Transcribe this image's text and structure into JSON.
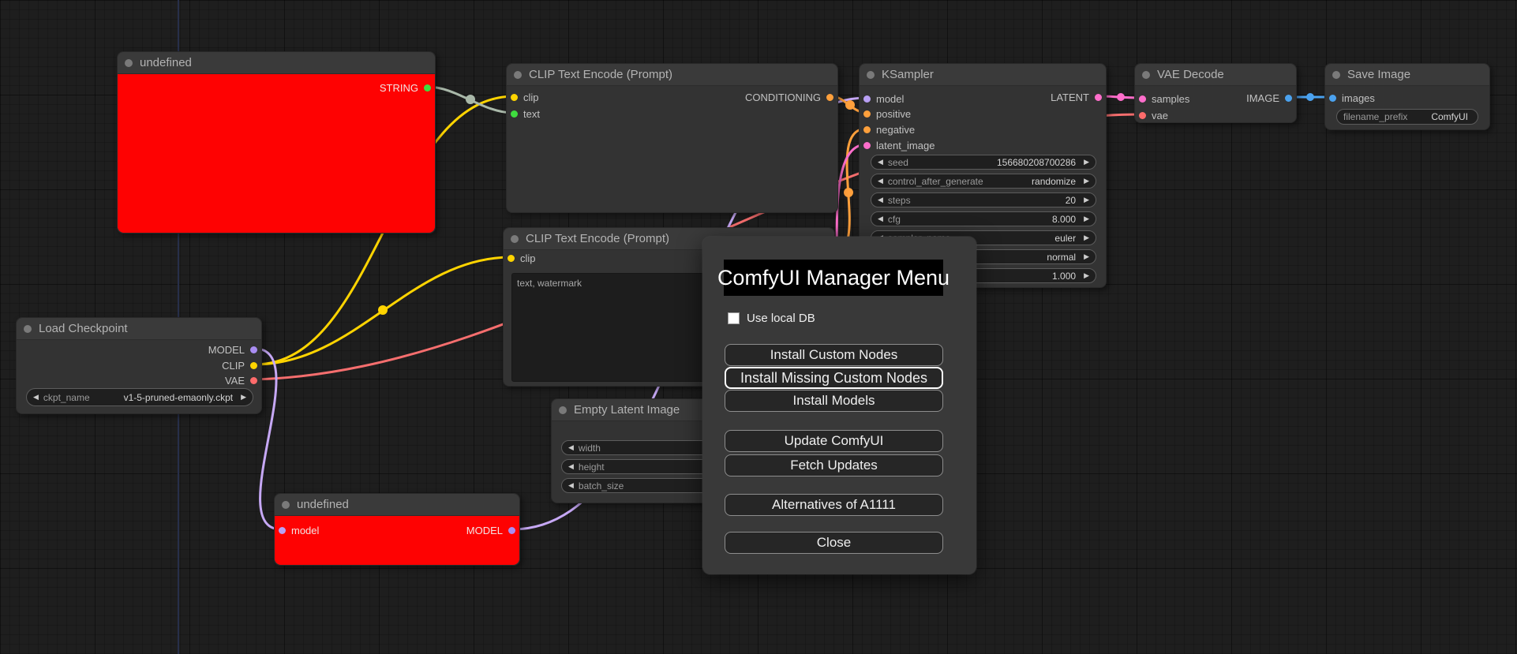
{
  "colors": {
    "canvas_bg": "#1e1e1e",
    "node_bg": "#333333",
    "node_header": "#3a3a3a",
    "error_node_red": "#fe0202",
    "wire_clip_yellow": "#ffd400",
    "wire_vae_salmon": "#f66e6e",
    "wire_model_purple": "#c6a8f5",
    "wire_conditioning_orange": "#ffa03c",
    "wire_latent_pink": "#ff6ecb",
    "wire_image_blue": "#4ba2ef",
    "wire_string_gray": "#a9b8a9",
    "slot_green": "#3fdd3f",
    "dialog_bg": "#393939"
  },
  "nodes": {
    "undefined_top": {
      "title": "undefined",
      "output": "STRING"
    },
    "clip_encode_1": {
      "title": "CLIP Text Encode (Prompt)",
      "inputs": [
        "clip",
        "text"
      ],
      "output": "CONDITIONING"
    },
    "clip_encode_2": {
      "title": "CLIP Text Encode (Prompt)",
      "inputs": [
        "clip"
      ],
      "text_value": "text, watermark"
    },
    "load_checkpoint": {
      "title": "Load Checkpoint",
      "outputs": [
        "MODEL",
        "CLIP",
        "VAE"
      ],
      "widget": {
        "label": "ckpt_name",
        "value": "v1-5-pruned-emaonly.ckpt"
      }
    },
    "ksampler": {
      "title": "KSampler",
      "inputs": [
        "model",
        "positive",
        "negative",
        "latent_image"
      ],
      "output": "LATENT",
      "widgets": [
        {
          "label": "seed",
          "value": "156680208700286"
        },
        {
          "label": "control_after_generate",
          "value": "randomize"
        },
        {
          "label": "steps",
          "value": "20"
        },
        {
          "label": "cfg",
          "value": "8.000"
        },
        {
          "label": "sampler_name",
          "value": "euler"
        },
        {
          "label": "",
          "value": "normal"
        },
        {
          "label": "",
          "value": "1.000"
        }
      ]
    },
    "empty_latent": {
      "title": "Empty Latent Image",
      "widgets": [
        {
          "label": "width",
          "value": ""
        },
        {
          "label": "height",
          "value": ""
        },
        {
          "label": "batch_size",
          "value": ""
        }
      ]
    },
    "vae_decode": {
      "title": "VAE Decode",
      "inputs": [
        "samples",
        "vae"
      ],
      "output": "IMAGE"
    },
    "save_image": {
      "title": "Save Image",
      "inputs": [
        "images"
      ],
      "widget": {
        "label": "filename_prefix",
        "value": "ComfyUI"
      }
    },
    "undefined_bottom": {
      "title": "undefined",
      "input": "model",
      "output": "MODEL"
    }
  },
  "dialog": {
    "title": "ComfyUI Manager Menu",
    "checkbox_label": "Use local DB",
    "checkbox_checked": false,
    "buttons": [
      "Install Custom Nodes",
      "Install Missing Custom Nodes",
      "Install Models",
      "Update ComfyUI",
      "Fetch Updates",
      "Alternatives of A1111",
      "Close"
    ]
  }
}
